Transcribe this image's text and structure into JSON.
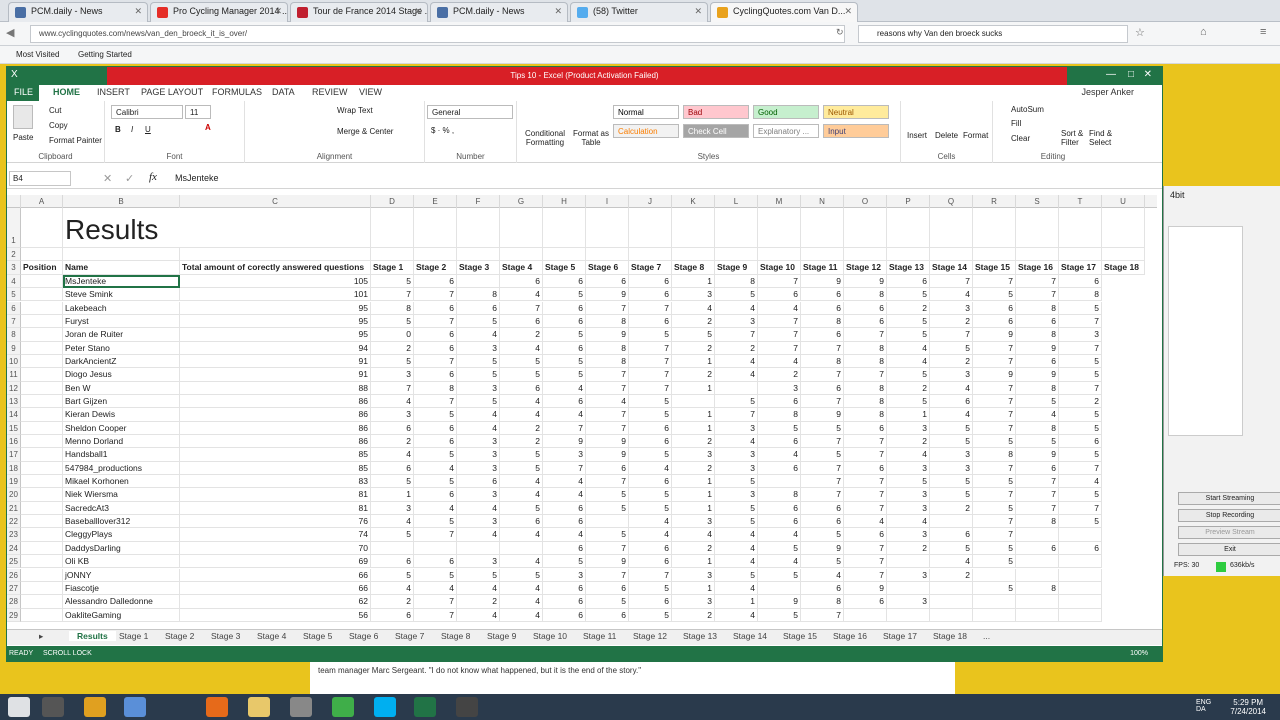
{
  "browser": {
    "tabs": [
      {
        "title": "PCM.daily - News",
        "color": "#4a6fa5"
      },
      {
        "title": "Pro Cycling Manager 2014 ...",
        "color": "#e52d27"
      },
      {
        "title": "Tour de France 2014 Stage ...",
        "color": "#c01f2f"
      },
      {
        "title": "PCM.daily - News",
        "color": "#4a6fa5"
      },
      {
        "title": "(58) Twitter",
        "color": "#55acee"
      },
      {
        "title": "CyclingQuotes.com Van D...",
        "color": "#e9a21d"
      }
    ],
    "url": "www.cyclingquotes.com/news/van_den_broeck_it_is_over/",
    "search_value": "reasons why Van den broeck sucks",
    "bookmarks": [
      "Most Visited",
      "Getting Started"
    ]
  },
  "excel": {
    "title": "Tips 10 - Excel (Product Activation Failed)",
    "user": "Jesper Anker",
    "ribbon_tabs": [
      "FILE",
      "HOME",
      "INSERT",
      "PAGE LAYOUT",
      "FORMULAS",
      "DATA",
      "REVIEW",
      "VIEW"
    ],
    "clipboard": {
      "paste": "Paste",
      "cut": "Cut",
      "copy": "Copy",
      "painter": "Format Painter",
      "label": "Clipboard"
    },
    "font": {
      "name": "Calibri",
      "size": "11",
      "label": "Font"
    },
    "alignment": {
      "wrap": "Wrap Text",
      "merge": "Merge & Center",
      "label": "Alignment"
    },
    "number": {
      "format": "General",
      "label": "Number"
    },
    "styles": {
      "cond": "Conditional Formatting",
      "table": "Format as Table",
      "label": "Styles",
      "cells": [
        {
          "text": "Normal",
          "bg": "#ffffff",
          "fg": "#000000"
        },
        {
          "text": "Bad",
          "bg": "#ffc7ce",
          "fg": "#9c0006"
        },
        {
          "text": "Good",
          "bg": "#c6efce",
          "fg": "#006100"
        },
        {
          "text": "Neutral",
          "bg": "#ffeb9c",
          "fg": "#9c5700"
        },
        {
          "text": "Calculation",
          "bg": "#f2f2f2",
          "fg": "#fa7d00"
        },
        {
          "text": "Check Cell",
          "bg": "#a5a5a5",
          "fg": "#ffffff"
        },
        {
          "text": "Explanatory ...",
          "bg": "#ffffff",
          "fg": "#7f7f7f"
        },
        {
          "text": "Input",
          "bg": "#ffcc99",
          "fg": "#3f3f76"
        }
      ]
    },
    "cells_group": {
      "insert": "Insert",
      "delete": "Delete",
      "format": "Format",
      "label": "Cells"
    },
    "editing": {
      "autosum": "AutoSum",
      "fill": "Fill",
      "clear": "Clear",
      "sort": "Sort & Filter",
      "find": "Find & Select",
      "label": "Editing"
    },
    "name_box": "B4",
    "formula": "MsJenteke",
    "columns": [
      "A",
      "B",
      "C",
      "D",
      "E",
      "F",
      "G",
      "H",
      "I",
      "J",
      "K",
      "L",
      "M",
      "N",
      "O",
      "P",
      "Q",
      "R",
      "S",
      "T",
      "U"
    ],
    "sheet_title": "Results",
    "headers": [
      "Position",
      "Name",
      "Total amount of corectly answered questions",
      "Stage 1",
      "Stage 2",
      "Stage 3",
      "Stage 4",
      "Stage 5",
      "Stage 6",
      "Stage 7",
      "Stage 8",
      "Stage 9",
      "Stage 10",
      "Stage 11",
      "Stage 12",
      "Stage 13",
      "Stage 14",
      "Stage 15",
      "Stage 16",
      "Stage 17",
      "Stage 18"
    ],
    "rows": [
      [
        "",
        "MsJenteke",
        "105",
        "5",
        "6",
        "",
        "6",
        "6",
        "6",
        "6",
        "1",
        "8",
        "7",
        "9",
        "9",
        "6",
        "7",
        "7",
        "7",
        "6"
      ],
      [
        "",
        "Steve Smink",
        "101",
        "7",
        "7",
        "8",
        "4",
        "5",
        "9",
        "6",
        "3",
        "5",
        "6",
        "6",
        "8",
        "5",
        "4",
        "5",
        "7",
        "8"
      ],
      [
        "",
        "Lakebeach",
        "95",
        "8",
        "6",
        "6",
        "7",
        "6",
        "7",
        "7",
        "4",
        "4",
        "4",
        "6",
        "6",
        "2",
        "3",
        "6",
        "8",
        "5"
      ],
      [
        "",
        "Furyst",
        "95",
        "5",
        "7",
        "5",
        "6",
        "6",
        "8",
        "6",
        "2",
        "3",
        "7",
        "8",
        "6",
        "5",
        "2",
        "6",
        "6",
        "7"
      ],
      [
        "",
        "Joran de Ruiter",
        "95",
        "0",
        "6",
        "4",
        "2",
        "5",
        "9",
        "5",
        "5",
        "7",
        "7",
        "6",
        "7",
        "5",
        "7",
        "9",
        "8",
        "3"
      ],
      [
        "",
        "Peter Stano",
        "94",
        "2",
        "6",
        "3",
        "4",
        "6",
        "8",
        "7",
        "2",
        "2",
        "7",
        "7",
        "8",
        "4",
        "5",
        "7",
        "9",
        "7"
      ],
      [
        "",
        "DarkAncientZ",
        "91",
        "5",
        "7",
        "5",
        "5",
        "5",
        "8",
        "7",
        "1",
        "4",
        "4",
        "8",
        "8",
        "4",
        "2",
        "7",
        "6",
        "5"
      ],
      [
        "",
        "Diogo Jesus",
        "91",
        "3",
        "6",
        "5",
        "5",
        "5",
        "7",
        "7",
        "2",
        "4",
        "2",
        "7",
        "7",
        "5",
        "3",
        "9",
        "9",
        "5"
      ],
      [
        "",
        "Ben W",
        "88",
        "7",
        "8",
        "3",
        "6",
        "4",
        "7",
        "7",
        "1",
        "",
        "3",
        "6",
        "8",
        "2",
        "4",
        "7",
        "8",
        "7"
      ],
      [
        "",
        "Bart Gijzen",
        "86",
        "4",
        "7",
        "5",
        "4",
        "6",
        "4",
        "5",
        "",
        "5",
        "6",
        "7",
        "8",
        "5",
        "6",
        "7",
        "5",
        "2"
      ],
      [
        "",
        "Kieran Dewis",
        "86",
        "3",
        "5",
        "4",
        "4",
        "4",
        "7",
        "5",
        "1",
        "7",
        "8",
        "9",
        "8",
        "1",
        "4",
        "7",
        "4",
        "5"
      ],
      [
        "",
        "Sheldon Cooper",
        "86",
        "6",
        "6",
        "4",
        "2",
        "7",
        "7",
        "6",
        "1",
        "3",
        "5",
        "5",
        "6",
        "3",
        "5",
        "7",
        "8",
        "5"
      ],
      [
        "",
        "Menno Dorland",
        "86",
        "2",
        "6",
        "3",
        "2",
        "9",
        "9",
        "6",
        "2",
        "4",
        "6",
        "7",
        "7",
        "2",
        "5",
        "5",
        "5",
        "6"
      ],
      [
        "",
        "Handsball1",
        "85",
        "4",
        "5",
        "3",
        "5",
        "3",
        "9",
        "5",
        "3",
        "3",
        "4",
        "5",
        "7",
        "4",
        "3",
        "8",
        "9",
        "5"
      ],
      [
        "",
        "547984_productions",
        "85",
        "6",
        "4",
        "3",
        "5",
        "7",
        "6",
        "4",
        "2",
        "3",
        "6",
        "7",
        "6",
        "3",
        "3",
        "7",
        "6",
        "7"
      ],
      [
        "",
        "Mikael Korhonen",
        "83",
        "5",
        "5",
        "6",
        "4",
        "4",
        "7",
        "6",
        "1",
        "5",
        "",
        "7",
        "7",
        "5",
        "5",
        "5",
        "7",
        "4"
      ],
      [
        "",
        "Niek Wiersma",
        "81",
        "1",
        "6",
        "3",
        "4",
        "4",
        "5",
        "5",
        "1",
        "3",
        "8",
        "7",
        "7",
        "3",
        "5",
        "7",
        "7",
        "5"
      ],
      [
        "",
        "SacredcAt3",
        "81",
        "3",
        "4",
        "4",
        "5",
        "6",
        "5",
        "5",
        "1",
        "5",
        "6",
        "6",
        "7",
        "3",
        "2",
        "5",
        "7",
        "7"
      ],
      [
        "",
        "Baseballlover312",
        "76",
        "4",
        "5",
        "3",
        "6",
        "6",
        "",
        "4",
        "3",
        "5",
        "6",
        "6",
        "4",
        "4",
        "",
        "7",
        "8",
        "5"
      ],
      [
        "",
        "CleggyPlays",
        "74",
        "5",
        "7",
        "4",
        "4",
        "4",
        "5",
        "4",
        "4",
        "4",
        "4",
        "5",
        "6",
        "3",
        "6",
        "7",
        "",
        ""
      ],
      [
        "",
        "DaddysDarling",
        "70",
        "",
        "",
        "",
        "",
        "6",
        "7",
        "6",
        "2",
        "4",
        "5",
        "9",
        "7",
        "2",
        "5",
        "5",
        "6",
        "6"
      ],
      [
        "",
        "Oli KB",
        "69",
        "6",
        "6",
        "3",
        "4",
        "5",
        "9",
        "6",
        "1",
        "4",
        "4",
        "5",
        "7",
        "",
        "4",
        "5",
        "",
        ""
      ],
      [
        "",
        "jONNY",
        "66",
        "5",
        "5",
        "5",
        "5",
        "3",
        "7",
        "7",
        "3",
        "5",
        "5",
        "4",
        "7",
        "3",
        "2",
        "",
        "",
        ""
      ],
      [
        "",
        "Fiascotje",
        "66",
        "4",
        "4",
        "4",
        "4",
        "6",
        "6",
        "5",
        "1",
        "4",
        "",
        "6",
        "9",
        "",
        "",
        "5",
        "8",
        ""
      ],
      [
        "",
        "Alessandro Dalledonne",
        "62",
        "2",
        "7",
        "2",
        "4",
        "6",
        "5",
        "6",
        "3",
        "1",
        "9",
        "8",
        "6",
        "3",
        "",
        "",
        "",
        ""
      ],
      [
        "",
        "OakliteGaming",
        "56",
        "6",
        "7",
        "4",
        "4",
        "6",
        "6",
        "5",
        "2",
        "4",
        "5",
        "7",
        "",
        "",
        "",
        "",
        "",
        ""
      ]
    ],
    "sheet_tabs": [
      "Results",
      "Stage 1",
      "Stage 2",
      "Stage 3",
      "Stage 4",
      "Stage 5",
      "Stage 6",
      "Stage 7",
      "Stage 8",
      "Stage 9",
      "Stage 10",
      "Stage 11",
      "Stage 12",
      "Stage 13",
      "Stage 14",
      "Stage 15",
      "Stage 16",
      "Stage 17",
      "Stage 18",
      "..."
    ],
    "status_ready": "READY",
    "status_scroll": "SCROLL LOCK",
    "zoom": "100%"
  },
  "obs": {
    "buttons": [
      "Start Streaming",
      "Stop Recording",
      "Preview Stream",
      "Exit"
    ],
    "fps": "FPS: 30",
    "rate": "636kb/s",
    "title_fragment": "4bit"
  },
  "article": {
    "line1": "team manager Marc Sergeant. \"I do not know what happened, but it is the end of the story.\""
  },
  "taskbar": {
    "time": "5:29 PM",
    "date": "7/24/2014",
    "lang": "ENG DA"
  }
}
